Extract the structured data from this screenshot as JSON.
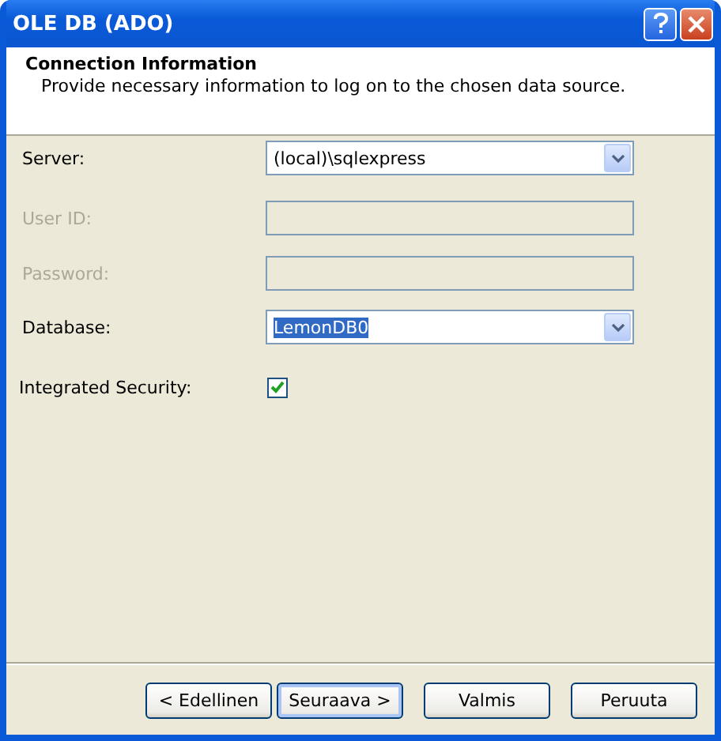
{
  "window": {
    "title": "OLE DB (ADO)"
  },
  "header": {
    "title": "Connection Information",
    "subtitle": "Provide necessary information to log on to the chosen data source."
  },
  "fields": [
    {
      "kind": "combo",
      "label": "Server:",
      "value": "(local)\\sqlexpress",
      "highlighted": false
    },
    {
      "kind": "text",
      "label": "User ID:",
      "disabled": true
    },
    {
      "kind": "text",
      "label": "Password:",
      "disabled": true
    },
    {
      "kind": "combo",
      "label": "Database:",
      "value": "LemonDB0",
      "highlighted": true
    },
    {
      "kind": "checkbox",
      "label": "Integrated Security:",
      "checked": true
    }
  ],
  "buttons": [
    {
      "label": "< Edellinen",
      "focused": false
    },
    {
      "label": "Seuraava >",
      "focused": true
    },
    {
      "label": "Valmis",
      "focused": false
    },
    {
      "label": "Peruuta",
      "focused": false
    }
  ]
}
